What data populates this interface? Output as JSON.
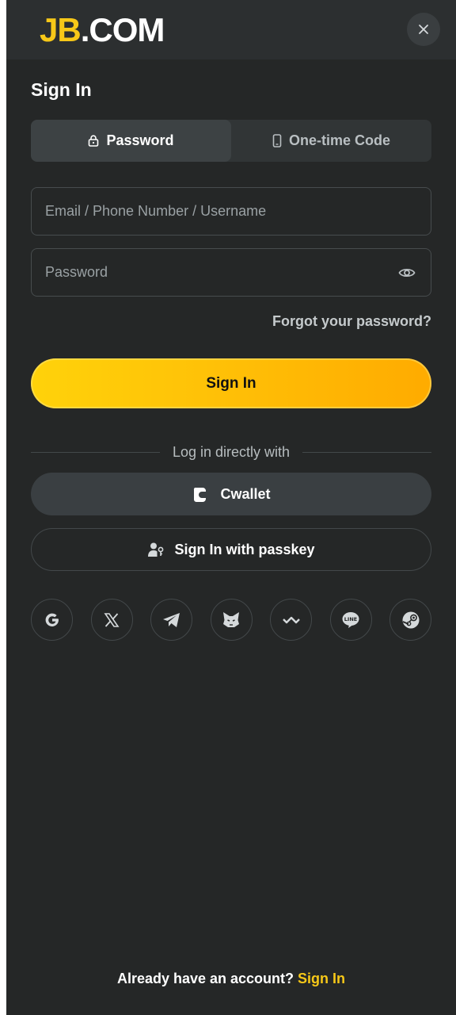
{
  "brand": {
    "logo_part1": "JB",
    "logo_part2": ".COM"
  },
  "header": {
    "title": "Sign In"
  },
  "tabs": [
    {
      "label": "Password",
      "icon": "lock-icon",
      "active": true
    },
    {
      "label": "One-time Code",
      "icon": "phone-icon",
      "active": false
    }
  ],
  "form": {
    "account_placeholder": "Email / Phone Number / Username",
    "account_value": "",
    "password_placeholder": "Password",
    "password_value": "",
    "forgot_label": "Forgot your password?",
    "submit_label": "Sign In"
  },
  "alt_login": {
    "divider_text": "Log in directly with",
    "cwallet_label": "Cwallet",
    "passkey_label": "Sign In with passkey"
  },
  "socials": [
    "google-icon",
    "x-icon",
    "telegram-icon",
    "metamask-icon",
    "walletconnect-icon",
    "line-icon",
    "steam-icon"
  ],
  "footer": {
    "prompt": "Already have an account?",
    "link": "Sign In"
  },
  "colors": {
    "accent": "#f7c818",
    "background": "#252727",
    "button_gradient_start": "#ffd20a",
    "button_gradient_end": "#ffab00"
  }
}
